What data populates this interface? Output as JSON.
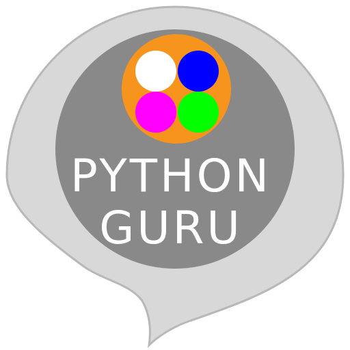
{
  "app_icon": {
    "title_line1": "PYTHON",
    "title_line2": "GURU",
    "colors": {
      "bubble_outer": "#d8d8d8",
      "bubble_border": "#b8b8b8",
      "inner_circle": "#898989",
      "orange_disc": "#f7941d",
      "dot_top_left": "#ffffff",
      "dot_top_right": "#0000ff",
      "dot_bottom_left": "#ff00ff",
      "dot_bottom_right": "#00ff00",
      "text": "#ffffff"
    }
  }
}
